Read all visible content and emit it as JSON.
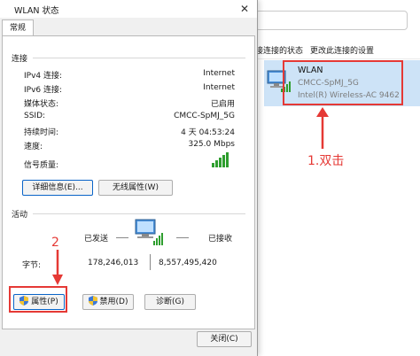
{
  "background": {
    "links": {
      "status": "接连接的状态",
      "rename": "更改此连接的设置"
    },
    "wlan_card": {
      "name": "WLAN",
      "network": "CMCC-SpMJ_5G",
      "adapter": "Intel(R) Wireless-AC 9462"
    },
    "annotation": "1.双击"
  },
  "dialog": {
    "title": "WLAN 状态",
    "close_glyph": "✕",
    "tab": "常规",
    "connection": {
      "label": "连接",
      "rows": [
        {
          "k": "IPv4 连接:",
          "v": "Internet"
        },
        {
          "k": "IPv6 连接:",
          "v": "Internet"
        },
        {
          "k": "媒体状态:",
          "v": "已启用"
        },
        {
          "k": "SSID:",
          "v": "CMCC-SpMJ_5G"
        },
        {
          "k": "持续时间:",
          "v": "4 天 04:53:24"
        },
        {
          "k": "速度:",
          "v": "325.0 Mbps"
        }
      ],
      "signal_label": "信号质量:",
      "details_button": "详细信息(E)...",
      "wireless_button": "无线属性(W)"
    },
    "activity": {
      "label": "活动",
      "sent_label": "已发送",
      "received_label": "已接收",
      "bytes_label": "字节:",
      "sent": "178,246,013",
      "received": "8,557,495,420"
    },
    "buttons": {
      "properties": "属性(P)",
      "disable": "禁用(D)",
      "diagnose": "诊断(G)",
      "close": "关闭(C)"
    },
    "annotation": "2"
  }
}
